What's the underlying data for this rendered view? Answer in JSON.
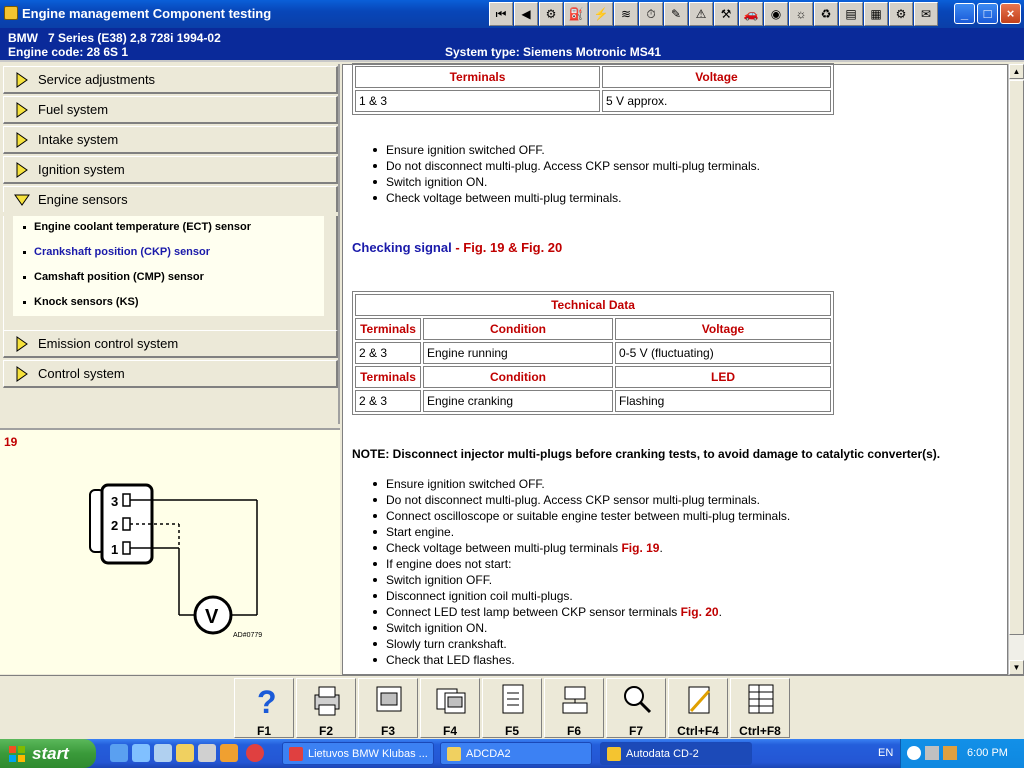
{
  "window": {
    "title": "Engine management Component testing"
  },
  "infobar": {
    "line1": "BMW   7 Series (E38) 2,8 728i 1994-02",
    "line2": "Engine code: 28 6S 1",
    "system": "System type: Siemens Motronic MS41"
  },
  "toolbar_icons": [
    "first-icon",
    "prev-icon",
    "engine-icon",
    "fuel-icon",
    "ignition-icon",
    "wiring-icon",
    "timing-icon",
    "tools-icon",
    "warning-icon",
    "service-icon",
    "car-icon",
    "diagnostics-icon",
    "lamp-icon",
    "emission-icon",
    "data-icon",
    "book-icon",
    "spanner-icon",
    "note-icon"
  ],
  "nav": {
    "items": [
      {
        "label": "Service adjustments"
      },
      {
        "label": "Fuel system"
      },
      {
        "label": "Intake system"
      },
      {
        "label": "Ignition system"
      },
      {
        "label": "Engine sensors"
      },
      {
        "label": "Emission control system"
      },
      {
        "label": "Control system"
      }
    ],
    "subitems": [
      {
        "label": "Engine coolant temperature (ECT) sensor"
      },
      {
        "label": "Crankshaft position (CKP) sensor"
      },
      {
        "label": "Camshaft position (CMP) sensor"
      },
      {
        "label": "Knock sensors (KS)"
      }
    ]
  },
  "figure": {
    "number": "19",
    "pins": [
      "3",
      "2",
      "1"
    ],
    "meter": "V",
    "code": "AD#0779"
  },
  "content": {
    "table1": {
      "headers": [
        "Terminals",
        "Voltage"
      ],
      "row": [
        "1 & 3",
        "5 V approx."
      ]
    },
    "bullets1": [
      "Ensure ignition switched OFF.",
      "Do not disconnect multi-plug. Access CKP sensor multi-plug terminals.",
      "Switch ignition ON.",
      "Check voltage between multi-plug terminals."
    ],
    "heading": {
      "text": "Checking signal",
      "sep": " - ",
      "fig1": "Fig. 19",
      "amp": " & ",
      "fig2": "Fig. 20"
    },
    "table2": {
      "title": "Technical Data",
      "headers1": [
        "Terminals",
        "Condition",
        "Voltage"
      ],
      "row1": [
        "2 & 3",
        "Engine running",
        "0-5 V (fluctuating)"
      ],
      "headers2": [
        "Terminals",
        "Condition",
        "LED"
      ],
      "row2": [
        "2 & 3",
        "Engine cranking",
        "Flashing"
      ]
    },
    "note": "NOTE: Disconnect injector multi-plugs before cranking tests, to avoid damage to catalytic converter(s).",
    "bullets2": [
      {
        "text": "Ensure ignition switched OFF.",
        "ref": ""
      },
      {
        "text": "Do not disconnect multi-plug. Access CKP sensor multi-plug terminals.",
        "ref": ""
      },
      {
        "text": "Connect oscilloscope or suitable engine tester between multi-plug terminals.",
        "ref": ""
      },
      {
        "text": "Start engine.",
        "ref": ""
      },
      {
        "text": "Check voltage between multi-plug terminals ",
        "ref": "Fig. 19",
        "tail": "."
      },
      {
        "text": "If engine does not start:",
        "ref": ""
      },
      {
        "text": "Switch ignition OFF.",
        "ref": ""
      },
      {
        "text": "Disconnect ignition coil multi-plugs.",
        "ref": ""
      },
      {
        "text": "Connect LED test lamp between CKP sensor terminals ",
        "ref": "Fig. 20",
        "tail": "."
      },
      {
        "text": "Switch ignition ON.",
        "ref": ""
      },
      {
        "text": "Slowly turn crankshaft.",
        "ref": ""
      },
      {
        "text": "Check that LED flashes.",
        "ref": ""
      }
    ]
  },
  "fkeys": [
    {
      "label": "F1",
      "icon": "help-icon"
    },
    {
      "label": "F2",
      "icon": "print-icon"
    },
    {
      "label": "F3",
      "icon": "picture-icon"
    },
    {
      "label": "F4",
      "icon": "pictures-icon"
    },
    {
      "label": "F5",
      "icon": "document-icon"
    },
    {
      "label": "F6",
      "icon": "connector-icon"
    },
    {
      "label": "F7",
      "icon": "magnifier-icon"
    },
    {
      "label": "Ctrl+F4",
      "icon": "notepad-icon"
    },
    {
      "label": "Ctrl+F8",
      "icon": "table-icon"
    }
  ],
  "taskbar": {
    "start": "start",
    "tasks": [
      {
        "label": "Lietuvos BMW Klubas ..."
      },
      {
        "label": "ADCDA2"
      },
      {
        "label": "Autodata CD-2"
      }
    ],
    "lang": "EN",
    "time": "6:00 PM"
  },
  "colors": {
    "accent_red": "#c00000",
    "link_blue": "#1a1aaa",
    "infobar": "#0a2a9a"
  }
}
